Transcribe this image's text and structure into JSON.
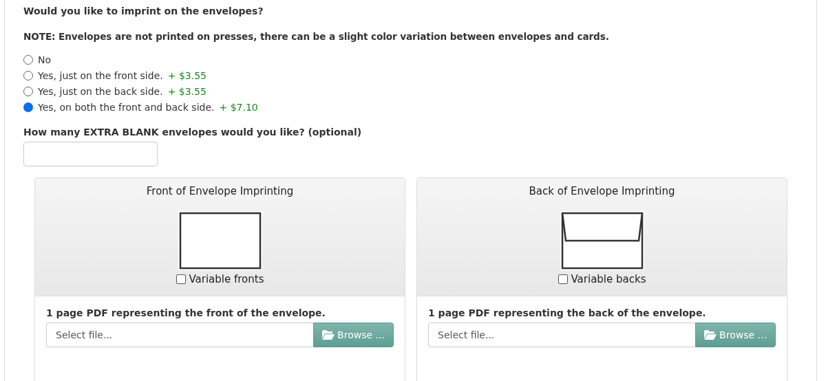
{
  "question": "Would you like to imprint on the envelopes?",
  "note": "NOTE: Envelopes are not printed on presses, there can be a slight color variation between envelopes and cards.",
  "options": [
    {
      "label": "No",
      "selected": false
    },
    {
      "label": "Yes, just on the front side.",
      "price": "+ $3.55",
      "selected": false
    },
    {
      "label": "Yes, just on the back side.",
      "price": "+ $3.55",
      "selected": false
    },
    {
      "label": "Yes, on both the front and back side.",
      "price": "+ $7.10",
      "selected": true
    }
  ],
  "extra_label": "How many EXTRA BLANK envelopes would you like? (optional)",
  "panels": [
    {
      "kind": "front",
      "title": "Front of Envelope Imprinting",
      "checkbox": {
        "label": "Variable fronts",
        "checked": false
      },
      "upload_label": "1 page PDF representing the front of the envelope.",
      "file_placeholder": "Select file...",
      "browse": "Browse ..."
    },
    {
      "kind": "back",
      "title": "Back of Envelope Imprinting",
      "checkbox": {
        "label": "Variable backs",
        "checked": false
      },
      "upload_label": "1 page PDF representing the back of the envelope.",
      "file_placeholder": "Select file...",
      "browse": "Browse ..."
    }
  ]
}
